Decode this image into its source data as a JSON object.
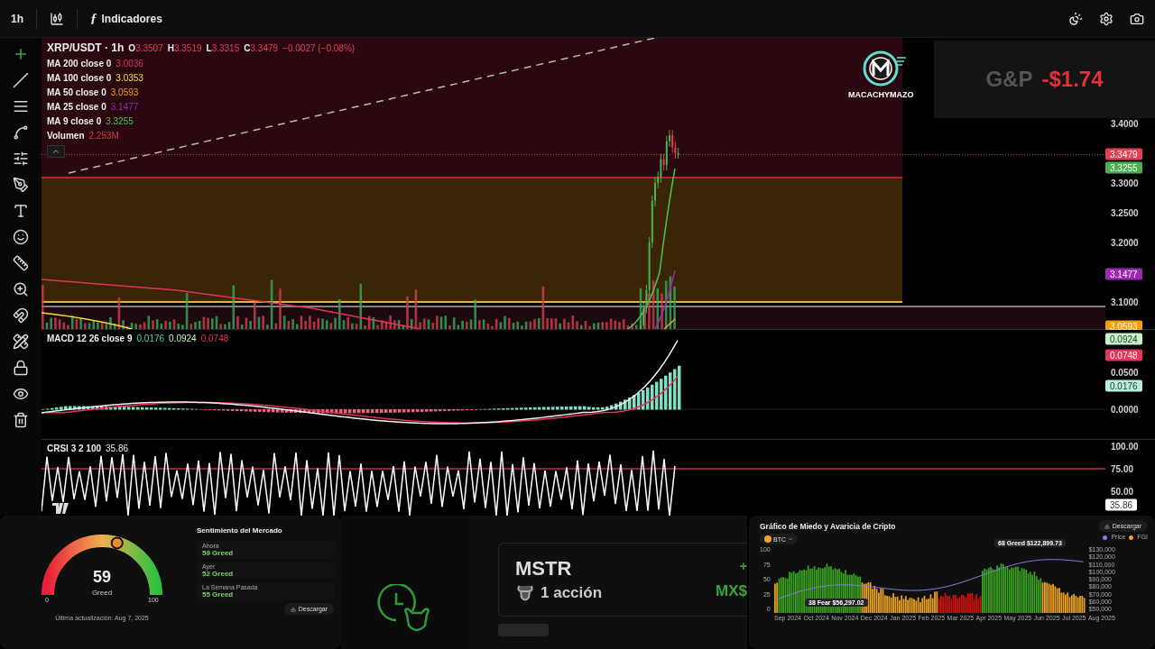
{
  "toolbar": {
    "interval": "1h",
    "function_symbol": "ƒ",
    "indicators_label": "Indicadores"
  },
  "main_chart": {
    "symbol": "XRP/USDT · 1h",
    "ohlc": [
      {
        "key": "O",
        "value": "3.3507"
      },
      {
        "key": "H",
        "value": "3.3519"
      },
      {
        "key": "L",
        "value": "3.3315"
      },
      {
        "key": "C",
        "value": "3.3479"
      }
    ],
    "change": "−0.0027 (−0.08%)",
    "indicators": [
      {
        "name": "MA 200 close 0",
        "value": "3.0036",
        "color": "#e0355a"
      },
      {
        "name": "MA 100 close 0",
        "value": "3.0353",
        "color": "#e8e03a"
      },
      {
        "name": "MA 50 close 0",
        "value": "3.0593",
        "color": "#f0a020"
      },
      {
        "name": "MA 25 close 0",
        "value": "3.1477",
        "color": "#8a2ab8"
      },
      {
        "name": "MA 9 close 0",
        "value": "3.3255",
        "color": "#4ec04e"
      },
      {
        "name": "Volumen",
        "value": "2.253M",
        "color": "#d03a4a"
      }
    ],
    "price_scale": [
      "3.4000",
      "3.3000",
      "3.2500",
      "3.2000",
      "3.1000"
    ],
    "price_tags": [
      {
        "value": "3.3479",
        "color": "#e0404f"
      },
      {
        "value": "3.3255",
        "color": "#4caf50"
      },
      {
        "value": "3.1477",
        "color": "#9c27b0"
      },
      {
        "value": "3.0593",
        "color": "#f5a000"
      }
    ]
  },
  "macd": {
    "title": "MACD 12 26 close 9",
    "values": [
      {
        "value": "0.0176",
        "color": "#4fd1b5"
      },
      {
        "value": "0.0924",
        "color": "#c8f0c8"
      },
      {
        "value": "0.0748",
        "color": "#e8335a"
      }
    ],
    "scale": [
      "0.0500",
      "0.0000"
    ],
    "tags": [
      {
        "value": "0.0924",
        "color": "#c8f0c8"
      },
      {
        "value": "0.0748",
        "color": "#e8335a"
      },
      {
        "value": "0.0176",
        "color": "#b8ece0"
      }
    ]
  },
  "crsi": {
    "title": "CRSI 3 2 100",
    "value": "35.86",
    "scale": [
      "100.00",
      "75.00",
      "50.00"
    ],
    "tag": "35.86"
  },
  "overlay": {
    "logo_text": "MACACHYMAZO",
    "pnl_label": "G&P",
    "pnl_value": "-$1.74"
  },
  "fear_greed": {
    "value": "59",
    "label": "Greed",
    "level": 0.59,
    "min": "0",
    "max": "100",
    "updated": "Última actualización: Aug 7, 2025",
    "sentiment_title": "Sentimiento del Mercado",
    "history": [
      {
        "period": "Ahora",
        "reading": "59 Greed"
      },
      {
        "period": "Ayer",
        "reading": "52 Greed"
      },
      {
        "period": "La Semana Pasada",
        "reading": "55 Greed"
      }
    ],
    "download_label": "Descargar"
  },
  "stock": {
    "ticker": "MSTR",
    "shares": "1 acción",
    "change": "+",
    "price": "MX$"
  },
  "fg_chart": {
    "title": "Gráfico de Miedo y Avaricia de Cripto",
    "download_label": "Descargar",
    "asset": "BTC",
    "legend": [
      "Price",
      "FGI"
    ],
    "left_ticks": [
      "100",
      "75",
      "50",
      "25",
      "0"
    ],
    "right_ticks": [
      "$130,000",
      "$120,000",
      "$110,000",
      "$100,000",
      "$90,000",
      "$80,000",
      "$70,000",
      "$60,000",
      "$50,000"
    ],
    "x_labels": [
      "Sep 2024",
      "Oct 2024",
      "Nov 2024",
      "Dec 2024",
      "Jan 2025",
      "Feb 2025",
      "Mar 2025",
      "Apr 2025",
      "May 2025",
      "Jun 2025",
      "Jul 2025",
      "Aug 2025"
    ],
    "tooltips": [
      {
        "text": "68 Greed $122,899.73"
      },
      {
        "text": "38 Fear $56,297.02"
      }
    ]
  }
}
